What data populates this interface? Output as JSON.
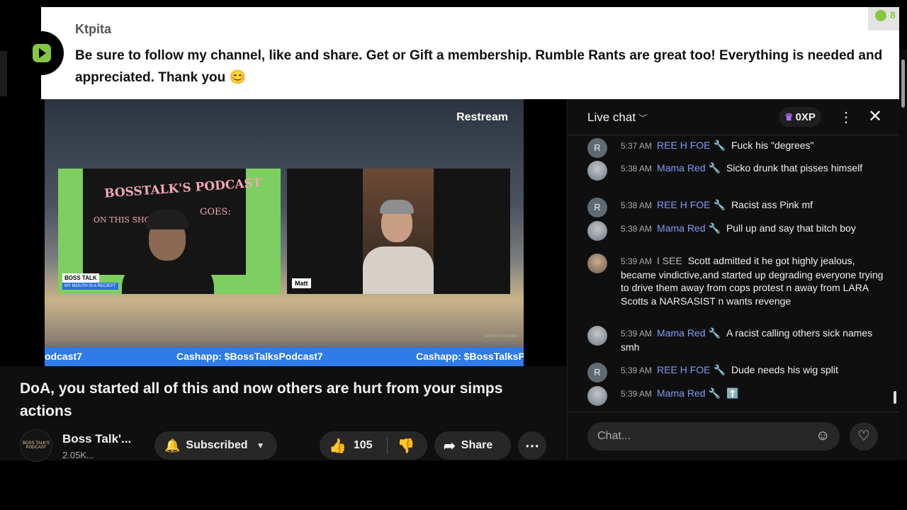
{
  "banner": {
    "username": "Ktpita",
    "message": "Be sure to follow my channel, like and share. Get or Gift a membership. Rumble Rants are great too! Everything is needed and appreciated. Thank you 😊",
    "corner_count": "8"
  },
  "video": {
    "watermark": "Restream",
    "host_sign_title": "BOSSTALK'S PODCAST",
    "host_sign_line2": "ON THIS SHOW",
    "host_sign_line3": "GOES:",
    "host_tag": "BOSS TALK",
    "host_subtag": "MY MOUTH IS A RECIEPT",
    "guest_tag": "Matt",
    "brand_corner": "DADDY'S PODCAST",
    "ticker": [
      "odcast7",
      "Cashapp: $BossTalksPodcast7",
      "Cashapp: $BossTalksP"
    ]
  },
  "details": {
    "title": "DoA, you started all of this and now others are hurt from your simps actions",
    "channel_name": "Boss Talk'...",
    "channel_subs": "2.05K...",
    "avatar_text": "BOSS TALK'S PODCAST",
    "subscribe_label": "Subscribed",
    "likes": "105",
    "share_label": "Share"
  },
  "chat": {
    "title": "Live chat",
    "xp": "0XP",
    "input_placeholder": "Chat...",
    "messages": [
      {
        "initial": "R",
        "time": "5:37 AM",
        "author": "REE H FOE",
        "text": "Fuck his \"degrees\""
      },
      {
        "initial": "",
        "time": "5:38 AM",
        "author": "Mama Red",
        "text": "Sicko drunk that pisses himself"
      },
      {
        "initial": "R",
        "time": "5:38 AM",
        "author": "REE H FOE",
        "text": "Racist ass Pink mf"
      },
      {
        "initial": "",
        "time": "5:38 AM",
        "author": "Mama Red",
        "text": "Pull up and say that bitch boy"
      },
      {
        "initial": "",
        "time": "5:39 AM",
        "author": "I SEE",
        "text": "Scott admitted it he got highly jealous, became vindictive,and started up degrading everyone trying to drive them away from cops protest n away from LARA Scotts a NARSASIST n wants revenge"
      },
      {
        "initial": "",
        "time": "5:39 AM",
        "author": "Mama Red",
        "text": "A racist calling others sick names smh"
      },
      {
        "initial": "R",
        "time": "5:39 AM",
        "author": "REE H FOE",
        "text": "Dude needs his wig split"
      },
      {
        "initial": "",
        "time": "5:39 AM",
        "author": "Mama Red",
        "text": "⬆️"
      }
    ]
  },
  "icons": {
    "crown": "crown-icon",
    "wrench": "wrench-icon",
    "bell": "bell-icon",
    "like": "thumbs-up-icon",
    "dislike": "thumbs-down-icon",
    "share": "share-arrow-icon",
    "more": "more-horizontal-icon",
    "emoji": "emoji-icon",
    "heart": "heart-icon"
  },
  "colors": {
    "rumble_green": "#85c742",
    "author_blue": "#7f9cf5",
    "ticker_blue": "#2f7be8",
    "crown_purple": "#b06ef7"
  }
}
